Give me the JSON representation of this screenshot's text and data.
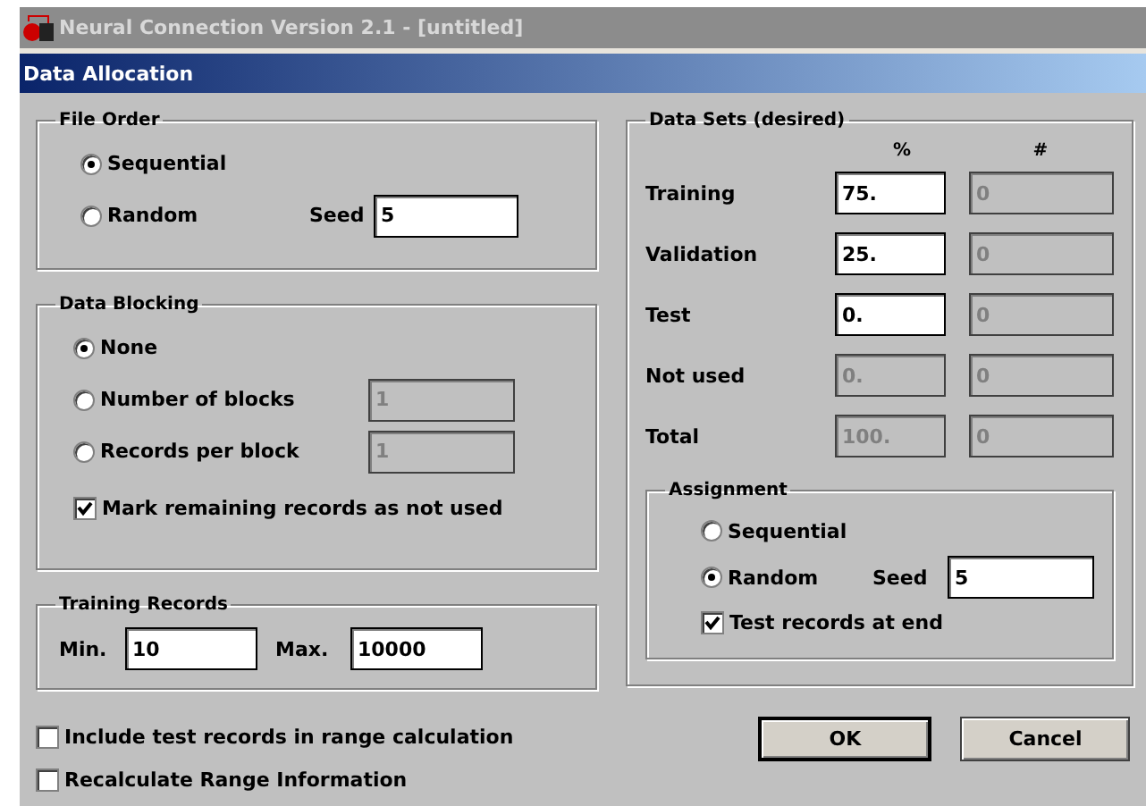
{
  "window": {
    "title": "Neural Connection Version 2.1 - [untitled]"
  },
  "dialog": {
    "title": "Data Allocation"
  },
  "file_order": {
    "title": "File Order",
    "options": [
      {
        "label": "Sequential",
        "selected": true
      },
      {
        "label": "Random",
        "selected": false
      }
    ],
    "seed": {
      "label": "Seed",
      "value": "5"
    }
  },
  "data_blocking": {
    "title": "Data Blocking",
    "options": [
      {
        "label": "None",
        "selected": true
      },
      {
        "label": "Number of blocks",
        "selected": false,
        "value": "1",
        "disabled": true
      },
      {
        "label": "Records per block",
        "selected": false,
        "value": "1",
        "disabled": true
      }
    ],
    "mark_remaining": {
      "label": "Mark remaining records as not used",
      "checked": true
    }
  },
  "training_records": {
    "title": "Training Records",
    "min": {
      "label": "Min.",
      "value": "10"
    },
    "max": {
      "label": "Max.",
      "value": "10000"
    }
  },
  "options": [
    {
      "label": "Include test records in range calculation",
      "checked": false
    },
    {
      "label": "Recalculate Range Information",
      "checked": false
    }
  ],
  "data_sets": {
    "title": "Data Sets (desired)",
    "columns": [
      "%",
      "#"
    ],
    "rows": [
      {
        "label": "Training",
        "percent": {
          "value": "75.",
          "disabled": false
        },
        "count": {
          "value": "0",
          "disabled": true
        }
      },
      {
        "label": "Validation",
        "percent": {
          "value": "25.",
          "disabled": false
        },
        "count": {
          "value": "0",
          "disabled": true
        }
      },
      {
        "label": "Test",
        "percent": {
          "value": "0.",
          "disabled": false
        },
        "count": {
          "value": "0",
          "disabled": true
        }
      },
      {
        "label": "Not used",
        "percent": {
          "value": "0.",
          "disabled": true
        },
        "count": {
          "value": "0",
          "disabled": true
        }
      },
      {
        "label": "Total",
        "percent": {
          "value": "100.",
          "disabled": true
        },
        "count": {
          "value": "0",
          "disabled": true
        }
      }
    ]
  },
  "assignment": {
    "title": "Assignment",
    "options": [
      {
        "label": "Sequential",
        "selected": false
      },
      {
        "label": "Random",
        "selected": true
      }
    ],
    "seed": {
      "label": "Seed",
      "value": "5"
    },
    "test_at_end": {
      "label": "Test records at end",
      "checked": true
    }
  },
  "buttons": [
    {
      "label": "OK",
      "default": true
    },
    {
      "label": "Cancel",
      "default": false
    }
  ]
}
